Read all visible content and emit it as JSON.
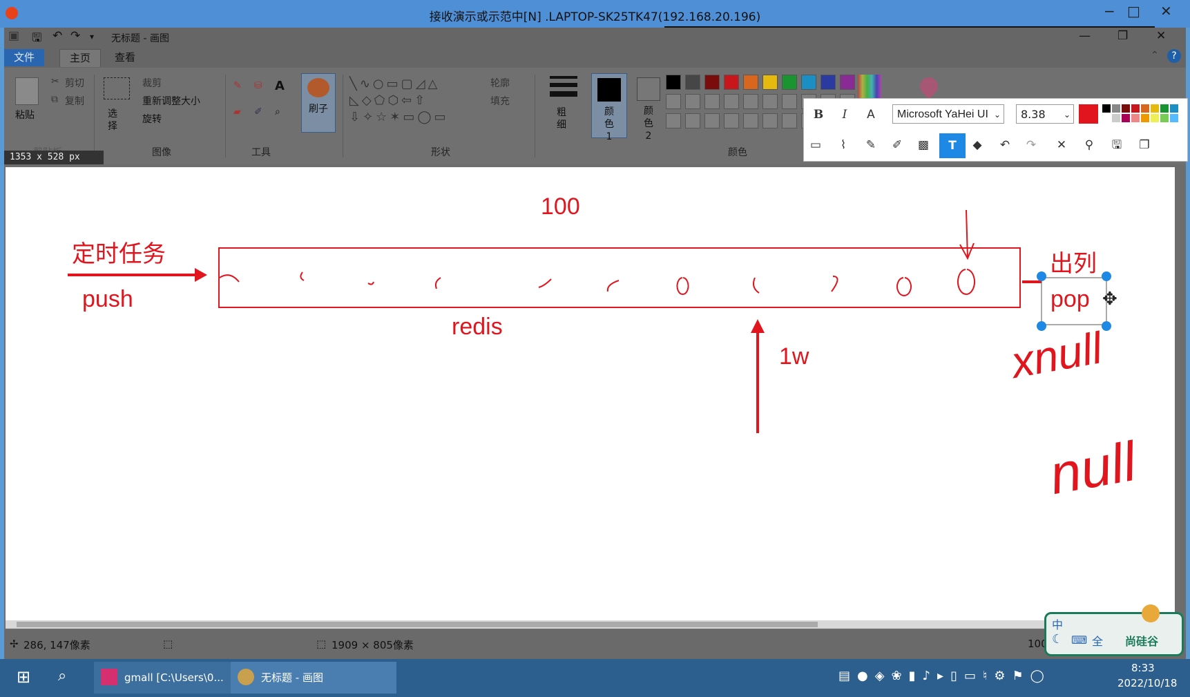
{
  "outer_window": {
    "title": "接收演示或示范中[N] .LAPTOP-SK25TK47(192.168.20.196)",
    "minimize": "−",
    "maximize": "□",
    "close": "✕"
  },
  "paint": {
    "title": "无标题 - 画图",
    "tabs": [
      "文件",
      "主页",
      "查看"
    ],
    "clipboard": {
      "paste": "粘贴",
      "cut": "剪切",
      "copy": "复制",
      "label": "剪贴板"
    },
    "image": {
      "select": "选择",
      "crop": "裁剪",
      "resize": "重新调整大小",
      "rotate": "旋转",
      "label": "图像"
    },
    "tools_label": "工具",
    "brush": "刷子",
    "shapes": {
      "outline": "轮廓",
      "fill": "填充",
      "label": "形状"
    },
    "size": "粗细",
    "color1": "颜色 1",
    "color2": "颜色 2",
    "colors_label": "颜色",
    "palette": [
      "#000000",
      "#464646",
      "#7b0c0c",
      "#c8171c",
      "#d9661f",
      "#e5b90d",
      "#1a9430",
      "#1b8ec4",
      "#2a3aa0",
      "#8a2a95"
    ],
    "size_badge": "1353 x 528  px",
    "status": {
      "cursor": "286, 147像素",
      "canvas_size": "1909 × 805像素",
      "zoom": "100"
    }
  },
  "screenshot_toolbar": {
    "font": "Microsoft YaHei UI",
    "font_size": "8.38",
    "bold": "B",
    "italic": "I",
    "outline": "A"
  },
  "canvas": {
    "label_100": "100",
    "label_timer": "定时任务",
    "label_push": "push",
    "label_redis": "redis",
    "label_1w": "1w",
    "label_out": "出列",
    "label_pop": "pop",
    "label_xnull": "xnull",
    "label_null": "null"
  },
  "taskbar": {
    "task1": "gmall [C:\\Users\\0...",
    "task2": "无标题 - 画图",
    "time": "8:33",
    "date": "2022/10/18",
    "ime_top": "中",
    "ime_brand": "尚硅谷",
    "ime_full": "全"
  }
}
